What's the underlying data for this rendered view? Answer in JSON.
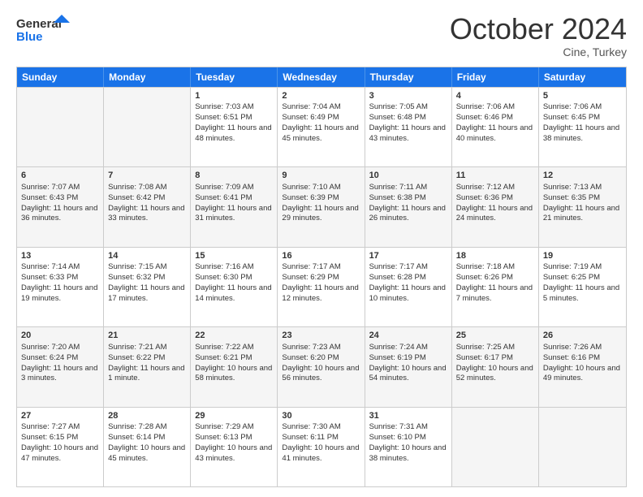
{
  "logo": {
    "line1": "General",
    "line2": "Blue"
  },
  "title": "October 2024",
  "location": "Cine, Turkey",
  "header_days": [
    "Sunday",
    "Monday",
    "Tuesday",
    "Wednesday",
    "Thursday",
    "Friday",
    "Saturday"
  ],
  "weeks": [
    [
      {
        "day": "",
        "sunrise": "",
        "sunset": "",
        "daylight": ""
      },
      {
        "day": "",
        "sunrise": "",
        "sunset": "",
        "daylight": ""
      },
      {
        "day": "1",
        "sunrise": "Sunrise: 7:03 AM",
        "sunset": "Sunset: 6:51 PM",
        "daylight": "Daylight: 11 hours and 48 minutes."
      },
      {
        "day": "2",
        "sunrise": "Sunrise: 7:04 AM",
        "sunset": "Sunset: 6:49 PM",
        "daylight": "Daylight: 11 hours and 45 minutes."
      },
      {
        "day": "3",
        "sunrise": "Sunrise: 7:05 AM",
        "sunset": "Sunset: 6:48 PM",
        "daylight": "Daylight: 11 hours and 43 minutes."
      },
      {
        "day": "4",
        "sunrise": "Sunrise: 7:06 AM",
        "sunset": "Sunset: 6:46 PM",
        "daylight": "Daylight: 11 hours and 40 minutes."
      },
      {
        "day": "5",
        "sunrise": "Sunrise: 7:06 AM",
        "sunset": "Sunset: 6:45 PM",
        "daylight": "Daylight: 11 hours and 38 minutes."
      }
    ],
    [
      {
        "day": "6",
        "sunrise": "Sunrise: 7:07 AM",
        "sunset": "Sunset: 6:43 PM",
        "daylight": "Daylight: 11 hours and 36 minutes."
      },
      {
        "day": "7",
        "sunrise": "Sunrise: 7:08 AM",
        "sunset": "Sunset: 6:42 PM",
        "daylight": "Daylight: 11 hours and 33 minutes."
      },
      {
        "day": "8",
        "sunrise": "Sunrise: 7:09 AM",
        "sunset": "Sunset: 6:41 PM",
        "daylight": "Daylight: 11 hours and 31 minutes."
      },
      {
        "day": "9",
        "sunrise": "Sunrise: 7:10 AM",
        "sunset": "Sunset: 6:39 PM",
        "daylight": "Daylight: 11 hours and 29 minutes."
      },
      {
        "day": "10",
        "sunrise": "Sunrise: 7:11 AM",
        "sunset": "Sunset: 6:38 PM",
        "daylight": "Daylight: 11 hours and 26 minutes."
      },
      {
        "day": "11",
        "sunrise": "Sunrise: 7:12 AM",
        "sunset": "Sunset: 6:36 PM",
        "daylight": "Daylight: 11 hours and 24 minutes."
      },
      {
        "day": "12",
        "sunrise": "Sunrise: 7:13 AM",
        "sunset": "Sunset: 6:35 PM",
        "daylight": "Daylight: 11 hours and 21 minutes."
      }
    ],
    [
      {
        "day": "13",
        "sunrise": "Sunrise: 7:14 AM",
        "sunset": "Sunset: 6:33 PM",
        "daylight": "Daylight: 11 hours and 19 minutes."
      },
      {
        "day": "14",
        "sunrise": "Sunrise: 7:15 AM",
        "sunset": "Sunset: 6:32 PM",
        "daylight": "Daylight: 11 hours and 17 minutes."
      },
      {
        "day": "15",
        "sunrise": "Sunrise: 7:16 AM",
        "sunset": "Sunset: 6:30 PM",
        "daylight": "Daylight: 11 hours and 14 minutes."
      },
      {
        "day": "16",
        "sunrise": "Sunrise: 7:17 AM",
        "sunset": "Sunset: 6:29 PM",
        "daylight": "Daylight: 11 hours and 12 minutes."
      },
      {
        "day": "17",
        "sunrise": "Sunrise: 7:17 AM",
        "sunset": "Sunset: 6:28 PM",
        "daylight": "Daylight: 11 hours and 10 minutes."
      },
      {
        "day": "18",
        "sunrise": "Sunrise: 7:18 AM",
        "sunset": "Sunset: 6:26 PM",
        "daylight": "Daylight: 11 hours and 7 minutes."
      },
      {
        "day": "19",
        "sunrise": "Sunrise: 7:19 AM",
        "sunset": "Sunset: 6:25 PM",
        "daylight": "Daylight: 11 hours and 5 minutes."
      }
    ],
    [
      {
        "day": "20",
        "sunrise": "Sunrise: 7:20 AM",
        "sunset": "Sunset: 6:24 PM",
        "daylight": "Daylight: 11 hours and 3 minutes."
      },
      {
        "day": "21",
        "sunrise": "Sunrise: 7:21 AM",
        "sunset": "Sunset: 6:22 PM",
        "daylight": "Daylight: 11 hours and 1 minute."
      },
      {
        "day": "22",
        "sunrise": "Sunrise: 7:22 AM",
        "sunset": "Sunset: 6:21 PM",
        "daylight": "Daylight: 10 hours and 58 minutes."
      },
      {
        "day": "23",
        "sunrise": "Sunrise: 7:23 AM",
        "sunset": "Sunset: 6:20 PM",
        "daylight": "Daylight: 10 hours and 56 minutes."
      },
      {
        "day": "24",
        "sunrise": "Sunrise: 7:24 AM",
        "sunset": "Sunset: 6:19 PM",
        "daylight": "Daylight: 10 hours and 54 minutes."
      },
      {
        "day": "25",
        "sunrise": "Sunrise: 7:25 AM",
        "sunset": "Sunset: 6:17 PM",
        "daylight": "Daylight: 10 hours and 52 minutes."
      },
      {
        "day": "26",
        "sunrise": "Sunrise: 7:26 AM",
        "sunset": "Sunset: 6:16 PM",
        "daylight": "Daylight: 10 hours and 49 minutes."
      }
    ],
    [
      {
        "day": "27",
        "sunrise": "Sunrise: 7:27 AM",
        "sunset": "Sunset: 6:15 PM",
        "daylight": "Daylight: 10 hours and 47 minutes."
      },
      {
        "day": "28",
        "sunrise": "Sunrise: 7:28 AM",
        "sunset": "Sunset: 6:14 PM",
        "daylight": "Daylight: 10 hours and 45 minutes."
      },
      {
        "day": "29",
        "sunrise": "Sunrise: 7:29 AM",
        "sunset": "Sunset: 6:13 PM",
        "daylight": "Daylight: 10 hours and 43 minutes."
      },
      {
        "day": "30",
        "sunrise": "Sunrise: 7:30 AM",
        "sunset": "Sunset: 6:11 PM",
        "daylight": "Daylight: 10 hours and 41 minutes."
      },
      {
        "day": "31",
        "sunrise": "Sunrise: 7:31 AM",
        "sunset": "Sunset: 6:10 PM",
        "daylight": "Daylight: 10 hours and 38 minutes."
      },
      {
        "day": "",
        "sunrise": "",
        "sunset": "",
        "daylight": ""
      },
      {
        "day": "",
        "sunrise": "",
        "sunset": "",
        "daylight": ""
      }
    ]
  ]
}
